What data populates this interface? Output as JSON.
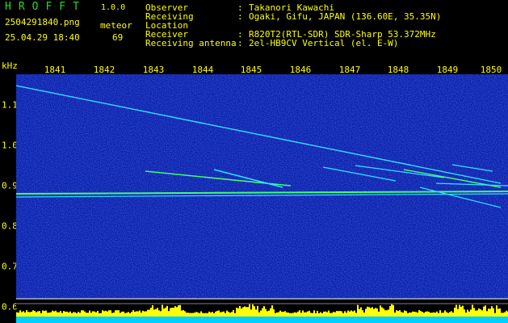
{
  "header": {
    "app_title": "HROFFT",
    "app_version": "1.0.0",
    "filename": "2504291840.png",
    "meteor_label": "meteor",
    "datetime": "25.04.29 18:40",
    "meteor_count": "69",
    "observer_key": "Observer",
    "observer_value": "Takanori Kawachi",
    "location_key": "Receiving Location",
    "location_value": "Ogaki, Gifu, JAPAN (136.60E, 35.35N)",
    "receiver_key": "Receiver",
    "receiver_value": "R820T2(RTL-SDR) SDR-Sharp 53.372MHz",
    "antenna_key": "Receiving antenna",
    "antenna_value": "2el-HB9CV Vertical (el. E-W)",
    "separator": ":"
  },
  "axes": {
    "y_unit": "kHz",
    "x_ticks": [
      "1841",
      "1842",
      "1843",
      "1844",
      "1845",
      "1846",
      "1847",
      "1848",
      "1849",
      "1850"
    ],
    "y_ticks": [
      "1.1",
      "1.0",
      "0.9",
      "0.8",
      "0.7",
      "0.6"
    ]
  },
  "colors": {
    "background": "#000000",
    "spectrum_bg": "#0a1aa8",
    "text": "#ffff00",
    "title": "#22dd22",
    "trace_cyan": "#30e0ff",
    "trace_green": "#40ff70",
    "level_bar": "#ffff00",
    "baseline": "#00d0ff"
  }
}
